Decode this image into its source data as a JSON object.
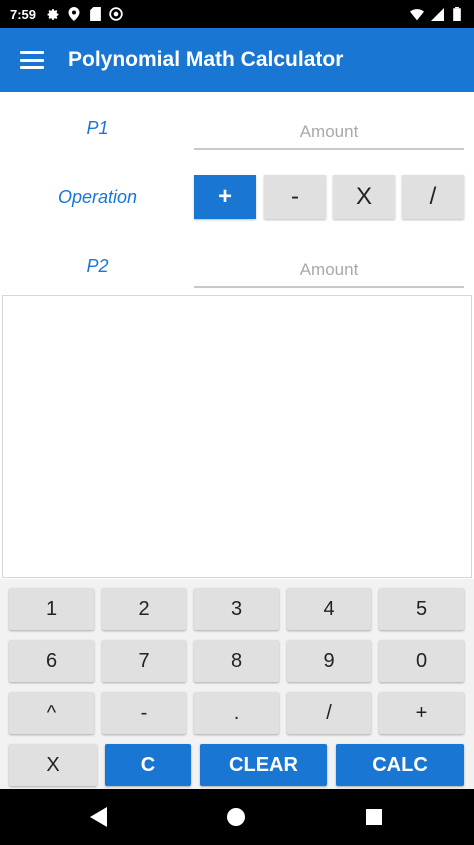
{
  "status_bar": {
    "time": "7:59",
    "icons": [
      "gear-icon",
      "location-icon",
      "sd-card-icon",
      "at-icon"
    ],
    "right_icons": [
      "wifi-icon",
      "signal-icon",
      "battery-icon"
    ]
  },
  "app_bar": {
    "title": "Polynomial Math Calculator",
    "menu_icon": "hamburger-menu-icon"
  },
  "form": {
    "p1_label": "P1",
    "p1_placeholder": "Amount",
    "operation_label": "Operation",
    "operations": [
      "+",
      "-",
      "X",
      "/"
    ],
    "selected_operation": "+",
    "p2_label": "P2",
    "p2_placeholder": "Amount"
  },
  "result": {
    "text": ""
  },
  "keypad": {
    "row1": [
      "1",
      "2",
      "3",
      "4",
      "5"
    ],
    "row2": [
      "6",
      "7",
      "8",
      "9",
      "0"
    ],
    "row3": [
      "^",
      "-",
      ".",
      "/",
      "+"
    ],
    "row4": [
      "X",
      "C",
      "CLEAR",
      "CALC"
    ]
  },
  "colors": {
    "primary": "#1976d2",
    "button_gray": "#e0e0e0",
    "keypad_bg": "#f2f2f2"
  },
  "nav_bar": {
    "icons": [
      "back-icon",
      "home-icon",
      "recents-icon"
    ]
  }
}
